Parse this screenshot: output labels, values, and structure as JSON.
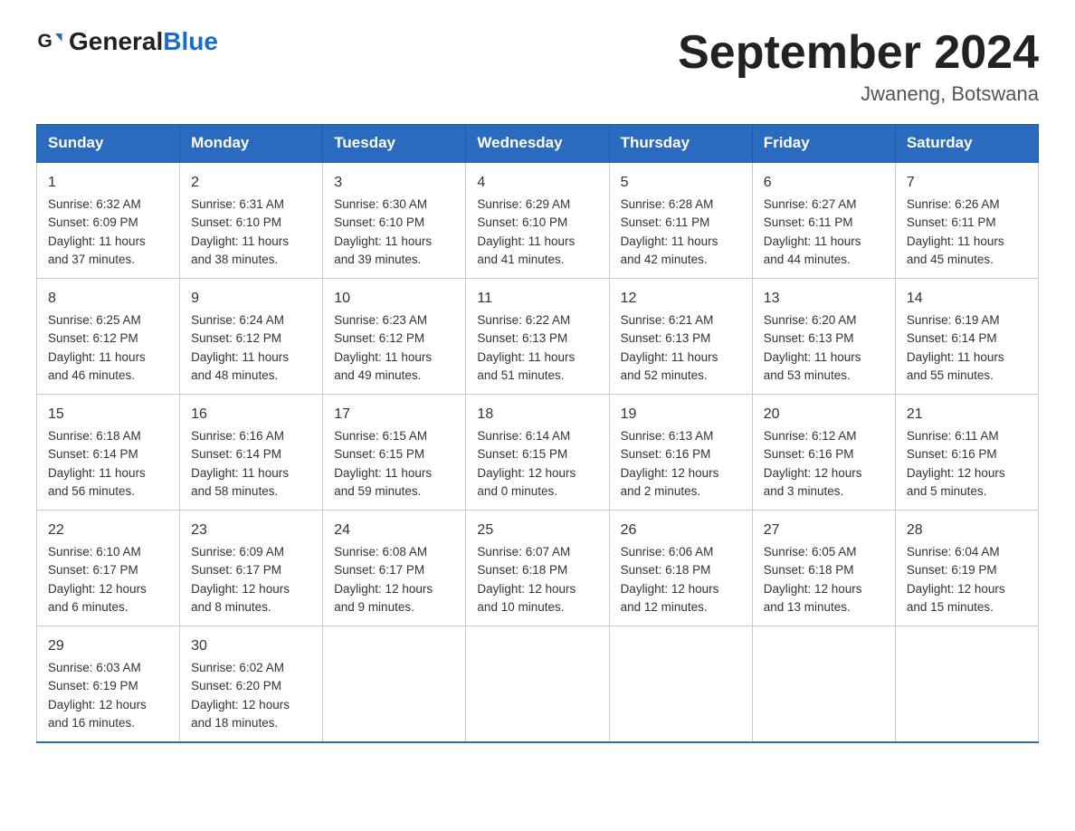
{
  "header": {
    "logo_general": "General",
    "logo_blue": "Blue",
    "title": "September 2024",
    "subtitle": "Jwaneng, Botswana"
  },
  "days_of_week": [
    "Sunday",
    "Monday",
    "Tuesday",
    "Wednesday",
    "Thursday",
    "Friday",
    "Saturday"
  ],
  "weeks": [
    [
      {
        "num": "1",
        "lines": [
          "Sunrise: 6:32 AM",
          "Sunset: 6:09 PM",
          "Daylight: 11 hours",
          "and 37 minutes."
        ]
      },
      {
        "num": "2",
        "lines": [
          "Sunrise: 6:31 AM",
          "Sunset: 6:10 PM",
          "Daylight: 11 hours",
          "and 38 minutes."
        ]
      },
      {
        "num": "3",
        "lines": [
          "Sunrise: 6:30 AM",
          "Sunset: 6:10 PM",
          "Daylight: 11 hours",
          "and 39 minutes."
        ]
      },
      {
        "num": "4",
        "lines": [
          "Sunrise: 6:29 AM",
          "Sunset: 6:10 PM",
          "Daylight: 11 hours",
          "and 41 minutes."
        ]
      },
      {
        "num": "5",
        "lines": [
          "Sunrise: 6:28 AM",
          "Sunset: 6:11 PM",
          "Daylight: 11 hours",
          "and 42 minutes."
        ]
      },
      {
        "num": "6",
        "lines": [
          "Sunrise: 6:27 AM",
          "Sunset: 6:11 PM",
          "Daylight: 11 hours",
          "and 44 minutes."
        ]
      },
      {
        "num": "7",
        "lines": [
          "Sunrise: 6:26 AM",
          "Sunset: 6:11 PM",
          "Daylight: 11 hours",
          "and 45 minutes."
        ]
      }
    ],
    [
      {
        "num": "8",
        "lines": [
          "Sunrise: 6:25 AM",
          "Sunset: 6:12 PM",
          "Daylight: 11 hours",
          "and 46 minutes."
        ]
      },
      {
        "num": "9",
        "lines": [
          "Sunrise: 6:24 AM",
          "Sunset: 6:12 PM",
          "Daylight: 11 hours",
          "and 48 minutes."
        ]
      },
      {
        "num": "10",
        "lines": [
          "Sunrise: 6:23 AM",
          "Sunset: 6:12 PM",
          "Daylight: 11 hours",
          "and 49 minutes."
        ]
      },
      {
        "num": "11",
        "lines": [
          "Sunrise: 6:22 AM",
          "Sunset: 6:13 PM",
          "Daylight: 11 hours",
          "and 51 minutes."
        ]
      },
      {
        "num": "12",
        "lines": [
          "Sunrise: 6:21 AM",
          "Sunset: 6:13 PM",
          "Daylight: 11 hours",
          "and 52 minutes."
        ]
      },
      {
        "num": "13",
        "lines": [
          "Sunrise: 6:20 AM",
          "Sunset: 6:13 PM",
          "Daylight: 11 hours",
          "and 53 minutes."
        ]
      },
      {
        "num": "14",
        "lines": [
          "Sunrise: 6:19 AM",
          "Sunset: 6:14 PM",
          "Daylight: 11 hours",
          "and 55 minutes."
        ]
      }
    ],
    [
      {
        "num": "15",
        "lines": [
          "Sunrise: 6:18 AM",
          "Sunset: 6:14 PM",
          "Daylight: 11 hours",
          "and 56 minutes."
        ]
      },
      {
        "num": "16",
        "lines": [
          "Sunrise: 6:16 AM",
          "Sunset: 6:14 PM",
          "Daylight: 11 hours",
          "and 58 minutes."
        ]
      },
      {
        "num": "17",
        "lines": [
          "Sunrise: 6:15 AM",
          "Sunset: 6:15 PM",
          "Daylight: 11 hours",
          "and 59 minutes."
        ]
      },
      {
        "num": "18",
        "lines": [
          "Sunrise: 6:14 AM",
          "Sunset: 6:15 PM",
          "Daylight: 12 hours",
          "and 0 minutes."
        ]
      },
      {
        "num": "19",
        "lines": [
          "Sunrise: 6:13 AM",
          "Sunset: 6:16 PM",
          "Daylight: 12 hours",
          "and 2 minutes."
        ]
      },
      {
        "num": "20",
        "lines": [
          "Sunrise: 6:12 AM",
          "Sunset: 6:16 PM",
          "Daylight: 12 hours",
          "and 3 minutes."
        ]
      },
      {
        "num": "21",
        "lines": [
          "Sunrise: 6:11 AM",
          "Sunset: 6:16 PM",
          "Daylight: 12 hours",
          "and 5 minutes."
        ]
      }
    ],
    [
      {
        "num": "22",
        "lines": [
          "Sunrise: 6:10 AM",
          "Sunset: 6:17 PM",
          "Daylight: 12 hours",
          "and 6 minutes."
        ]
      },
      {
        "num": "23",
        "lines": [
          "Sunrise: 6:09 AM",
          "Sunset: 6:17 PM",
          "Daylight: 12 hours",
          "and 8 minutes."
        ]
      },
      {
        "num": "24",
        "lines": [
          "Sunrise: 6:08 AM",
          "Sunset: 6:17 PM",
          "Daylight: 12 hours",
          "and 9 minutes."
        ]
      },
      {
        "num": "25",
        "lines": [
          "Sunrise: 6:07 AM",
          "Sunset: 6:18 PM",
          "Daylight: 12 hours",
          "and 10 minutes."
        ]
      },
      {
        "num": "26",
        "lines": [
          "Sunrise: 6:06 AM",
          "Sunset: 6:18 PM",
          "Daylight: 12 hours",
          "and 12 minutes."
        ]
      },
      {
        "num": "27",
        "lines": [
          "Sunrise: 6:05 AM",
          "Sunset: 6:18 PM",
          "Daylight: 12 hours",
          "and 13 minutes."
        ]
      },
      {
        "num": "28",
        "lines": [
          "Sunrise: 6:04 AM",
          "Sunset: 6:19 PM",
          "Daylight: 12 hours",
          "and 15 minutes."
        ]
      }
    ],
    [
      {
        "num": "29",
        "lines": [
          "Sunrise: 6:03 AM",
          "Sunset: 6:19 PM",
          "Daylight: 12 hours",
          "and 16 minutes."
        ]
      },
      {
        "num": "30",
        "lines": [
          "Sunrise: 6:02 AM",
          "Sunset: 6:20 PM",
          "Daylight: 12 hours",
          "and 18 minutes."
        ]
      },
      {
        "num": "",
        "lines": []
      },
      {
        "num": "",
        "lines": []
      },
      {
        "num": "",
        "lines": []
      },
      {
        "num": "",
        "lines": []
      },
      {
        "num": "",
        "lines": []
      }
    ]
  ]
}
